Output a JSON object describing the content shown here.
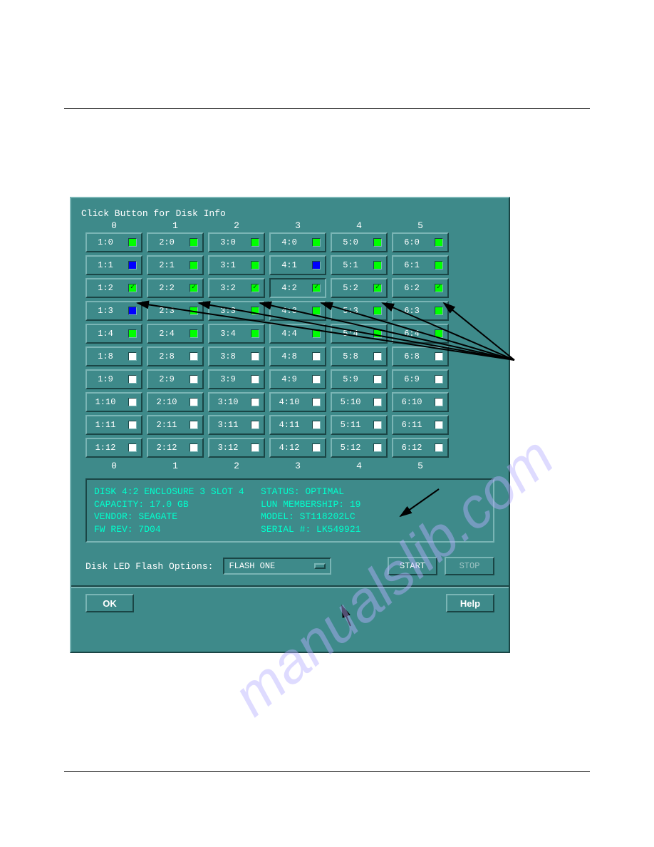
{
  "title": "Click Button for Disk Info",
  "columns_top": [
    "0",
    "1",
    "2",
    "3",
    "4",
    "5"
  ],
  "columns_bottom": [
    "0",
    "1",
    "2",
    "3",
    "4",
    "5"
  ],
  "rows": [
    {
      "labels": [
        "1:0",
        "2:0",
        "3:0",
        "4:0",
        "5:0",
        "6:0"
      ],
      "state": "green",
      "check": [
        false,
        false,
        false,
        false,
        false,
        false
      ]
    },
    {
      "labels": [
        "1:1",
        "2:1",
        "3:1",
        "4:1",
        "5:1",
        "6:1"
      ],
      "state": "mix",
      "states": [
        "blue",
        "green",
        "green",
        "blue",
        "green",
        "green"
      ],
      "check": [
        false,
        false,
        false,
        false,
        false,
        false
      ]
    },
    {
      "labels": [
        "1:2",
        "2:2",
        "3:2",
        "4:2",
        "5:2",
        "6:2"
      ],
      "state": "green",
      "check": [
        true,
        true,
        true,
        true,
        true,
        true
      ],
      "selected": 3
    },
    {
      "labels": [
        "1:3",
        "2:3",
        "3:3",
        "4:3",
        "5:3",
        "6:3"
      ],
      "state": "mix",
      "states": [
        "blue",
        "green",
        "green",
        "green",
        "green",
        "green"
      ],
      "check": [
        false,
        false,
        false,
        false,
        false,
        false
      ]
    },
    {
      "labels": [
        "1:4",
        "2:4",
        "3:4",
        "4:4",
        "5:4",
        "6:4"
      ],
      "state": "green",
      "check": [
        false,
        false,
        false,
        false,
        false,
        false
      ]
    },
    {
      "labels": [
        "1:8",
        "2:8",
        "3:8",
        "4:8",
        "5:8",
        "6:8"
      ],
      "state": "white",
      "check": [
        false,
        false,
        false,
        false,
        false,
        false
      ]
    },
    {
      "labels": [
        "1:9",
        "2:9",
        "3:9",
        "4:9",
        "5:9",
        "6:9"
      ],
      "state": "white",
      "check": [
        false,
        false,
        false,
        false,
        false,
        false
      ]
    },
    {
      "labels": [
        "1:10",
        "2:10",
        "3:10",
        "4:10",
        "5:10",
        "6:10"
      ],
      "state": "white",
      "check": [
        false,
        false,
        false,
        false,
        false,
        false
      ]
    },
    {
      "labels": [
        "1:11",
        "2:11",
        "3:11",
        "4:11",
        "5:11",
        "6:11"
      ],
      "state": "white",
      "check": [
        false,
        false,
        false,
        false,
        false,
        false
      ]
    },
    {
      "labels": [
        "1:12",
        "2:12",
        "3:12",
        "4:12",
        "5:12",
        "6:12"
      ],
      "state": "white",
      "check": [
        false,
        false,
        false,
        false,
        false,
        false
      ]
    }
  ],
  "info": {
    "line1_left": "DISK 4:2 ENCLOSURE 3 SLOT 4",
    "line1_right": "STATUS: OPTIMAL",
    "line2_left": "CAPACITY: 17.0 GB",
    "line2_right": "LUN MEMBERSHIP: 19",
    "line3_left": "VENDOR: SEAGATE",
    "line3_right": "MODEL: ST118202LC",
    "line4_left": "FW REV: 7D04",
    "line4_right": "SERIAL #: LK549921"
  },
  "led_label": "Disk LED Flash Options:",
  "led_value": "FLASH ONE",
  "start_label": "START",
  "stop_label": "STOP",
  "ok_label": "OK",
  "help_label": "Help"
}
